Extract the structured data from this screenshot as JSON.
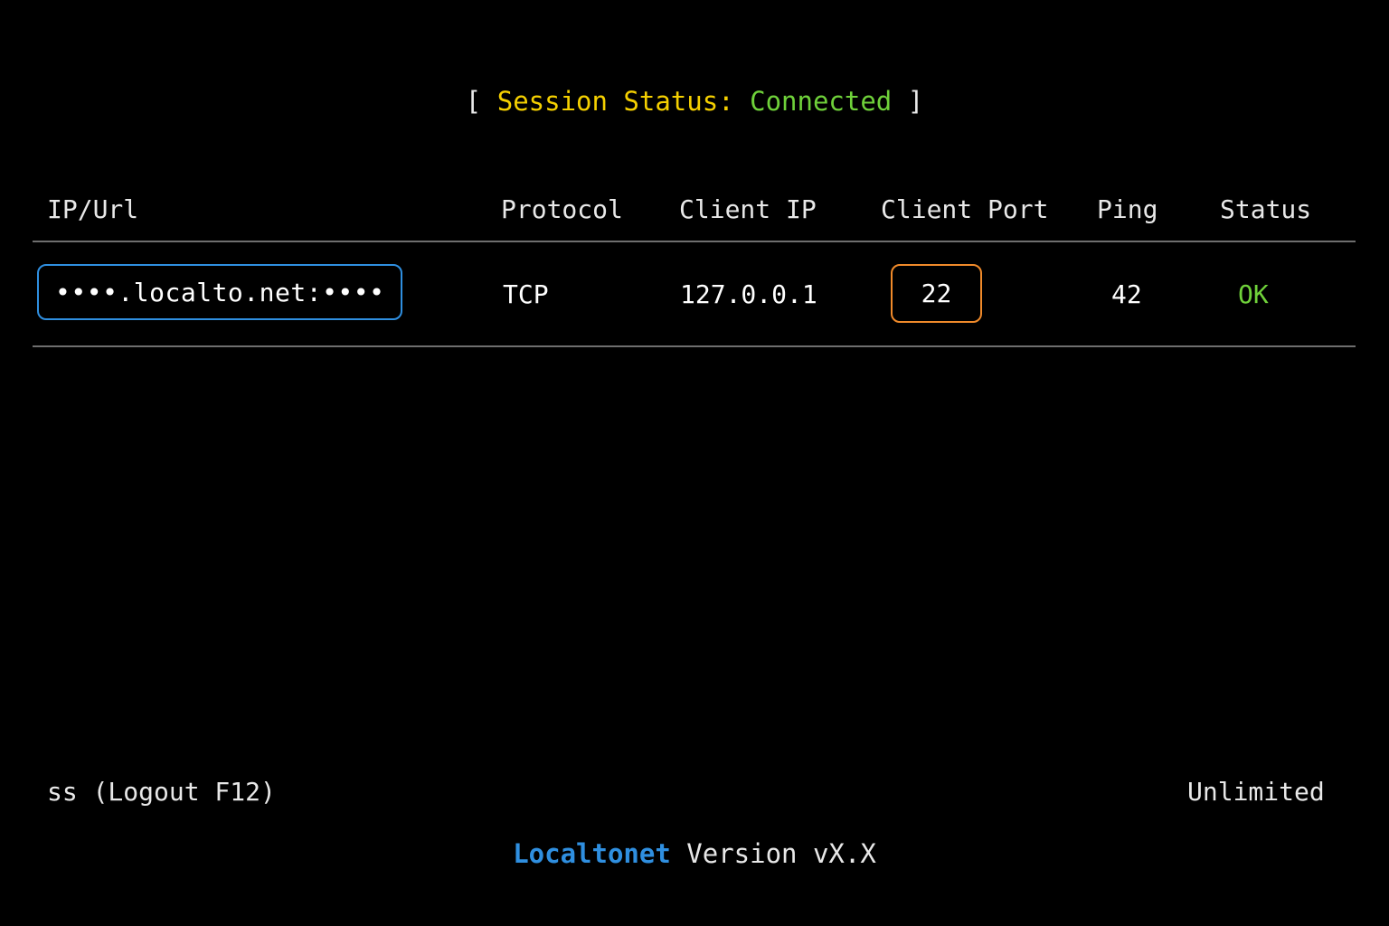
{
  "header": {
    "open_bracket": "[",
    "session_label": "Session Status:",
    "session_value": "Connected",
    "close_bracket": "]"
  },
  "table": {
    "columns": [
      "IP/Url",
      "Protocol",
      "Client IP",
      "Client Port",
      "Ping",
      "Status"
    ],
    "rows": [
      {
        "url": "••••.localto.net:••••",
        "protocol": "TCP",
        "client_ip": "127.0.0.1",
        "client_port": "22",
        "ping": "42",
        "status": "OK"
      }
    ]
  },
  "footer": {
    "left": "ss (Logout F12)",
    "right": "Unlimited",
    "brand": "Localtonet",
    "version": "Version vX.X"
  },
  "colors": {
    "background": "#000000",
    "session_label": "#f5d000",
    "connected": "#6fd13a",
    "url_border": "#2f8fe0",
    "port_border": "#f08a2a",
    "brand": "#2f8fe0"
  }
}
